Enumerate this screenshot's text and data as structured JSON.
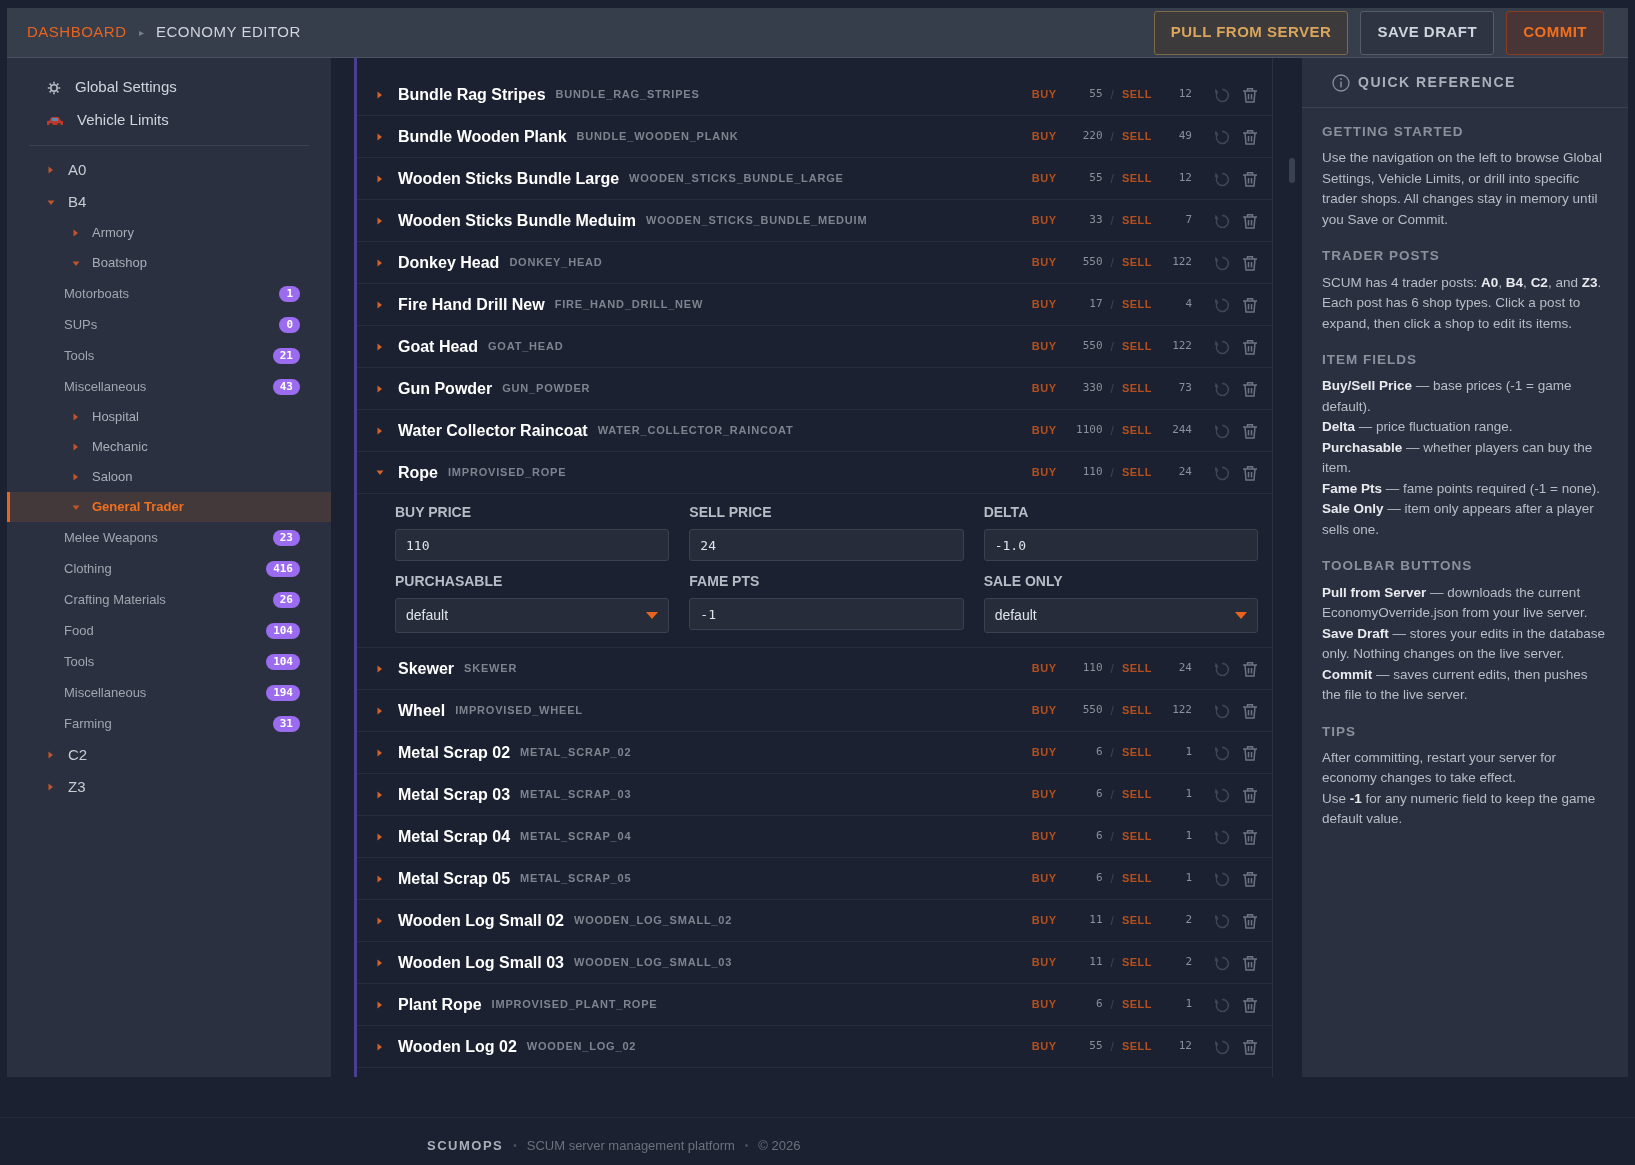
{
  "header": {
    "breadcrumb": [
      {
        "kind": "link",
        "text": "DASHBOARD"
      },
      {
        "kind": "sep",
        "text": "▸"
      },
      {
        "kind": "current",
        "text": "ECONOMY EDITOR"
      }
    ],
    "buttons": [
      {
        "kind": "pull",
        "label": "PULL FROM SERVER"
      },
      {
        "kind": "save",
        "label": "SAVE DRAFT"
      },
      {
        "kind": "commit",
        "label": "COMMIT"
      }
    ]
  },
  "sidebar": {
    "top_items": [
      {
        "kind": "gear",
        "label": "Global Settings"
      },
      {
        "kind": "car",
        "label": "Vehicle Limits"
      }
    ],
    "posts": [
      {
        "label": "A0",
        "expanded": false
      },
      {
        "label": "B4",
        "expanded": true,
        "children": [
          {
            "label": "Armory",
            "expanded": false,
            "selected": false
          },
          {
            "label": "Boatshop",
            "expanded": true,
            "selected": false,
            "children": [
              {
                "label": "Motorboats",
                "count": "1"
              },
              {
                "label": "SUPs",
                "count": "0"
              },
              {
                "label": "Tools",
                "count": "21"
              },
              {
                "label": "Miscellaneous",
                "count": "43"
              }
            ]
          },
          {
            "label": "Hospital",
            "expanded": false,
            "selected": false
          },
          {
            "label": "Mechanic",
            "expanded": false,
            "selected": false
          },
          {
            "label": "Saloon",
            "expanded": false,
            "selected": false
          },
          {
            "label": "General Trader",
            "expanded": true,
            "selected": true,
            "children": [
              {
                "label": "Melee Weapons",
                "count": "23"
              },
              {
                "label": "Clothing",
                "count": "416"
              },
              {
                "label": "Crafting Materials",
                "count": "26"
              },
              {
                "label": "Food",
                "count": "104"
              },
              {
                "label": "Tools",
                "count": "104"
              },
              {
                "label": "Miscellaneous",
                "count": "194"
              },
              {
                "label": "Farming",
                "count": "31"
              }
            ]
          }
        ]
      },
      {
        "label": "C2",
        "expanded": false
      },
      {
        "label": "Z3",
        "expanded": false
      }
    ]
  },
  "items": [
    {
      "name": "Bundle Rag Stripes",
      "code": "BUNDLE_RAG_STRIPES",
      "buy_label": "BUY",
      "buy": "55",
      "divider": "/",
      "sell_label": "SELL",
      "sell": "12",
      "expanded": false
    },
    {
      "name": "Bundle Wooden Plank",
      "code": "BUNDLE_WOODEN_PLANK",
      "buy_label": "BUY",
      "buy": "220",
      "divider": "/",
      "sell_label": "SELL",
      "sell": "49",
      "expanded": false
    },
    {
      "name": "Wooden Sticks Bundle Large",
      "code": "WOODEN_STICKS_BUNDLE_LARGE",
      "buy_label": "BUY",
      "buy": "55",
      "divider": "/",
      "sell_label": "SELL",
      "sell": "12",
      "expanded": false
    },
    {
      "name": "Wooden Sticks Bundle Meduim",
      "code": "WOODEN_STICKS_BUNDLE_MEDUIM",
      "buy_label": "BUY",
      "buy": "33",
      "divider": "/",
      "sell_label": "SELL",
      "sell": "7",
      "expanded": false
    },
    {
      "name": "Donkey Head",
      "code": "DONKEY_HEAD",
      "buy_label": "BUY",
      "buy": "550",
      "divider": "/",
      "sell_label": "SELL",
      "sell": "122",
      "expanded": false
    },
    {
      "name": "Fire Hand Drill New",
      "code": "FIRE_HAND_DRILL_NEW",
      "buy_label": "BUY",
      "buy": "17",
      "divider": "/",
      "sell_label": "SELL",
      "sell": "4",
      "expanded": false
    },
    {
      "name": "Goat Head",
      "code": "GOAT_HEAD",
      "buy_label": "BUY",
      "buy": "550",
      "divider": "/",
      "sell_label": "SELL",
      "sell": "122",
      "expanded": false
    },
    {
      "name": "Gun Powder",
      "code": "GUN_POWDER",
      "buy_label": "BUY",
      "buy": "330",
      "divider": "/",
      "sell_label": "SELL",
      "sell": "73",
      "expanded": false
    },
    {
      "name": "Water Collector Raincoat",
      "code": "WATER_COLLECTOR_RAINCOAT",
      "buy_label": "BUY",
      "buy": "1100",
      "divider": "/",
      "sell_label": "SELL",
      "sell": "244",
      "expanded": false
    },
    {
      "name": "Rope",
      "code": "IMPROVISED_ROPE",
      "buy_label": "BUY",
      "buy": "110",
      "divider": "/",
      "sell_label": "SELL",
      "sell": "24",
      "expanded": true,
      "fields": [
        {
          "label": "BUY PRICE",
          "kind": "input",
          "value": "110"
        },
        {
          "label": "SELL PRICE",
          "kind": "input",
          "value": "24"
        },
        {
          "label": "DELTA",
          "kind": "input",
          "value": "-1.0"
        },
        {
          "label": "PURCHASABLE",
          "kind": "select",
          "value": "default"
        },
        {
          "label": "FAME PTS",
          "kind": "input",
          "value": "-1"
        },
        {
          "label": "SALE ONLY",
          "kind": "select",
          "value": "default"
        }
      ]
    },
    {
      "name": "Skewer",
      "code": "SKEWER",
      "buy_label": "BUY",
      "buy": "110",
      "divider": "/",
      "sell_label": "SELL",
      "sell": "24",
      "expanded": false
    },
    {
      "name": "Wheel",
      "code": "IMPROVISED_WHEEL",
      "buy_label": "BUY",
      "buy": "550",
      "divider": "/",
      "sell_label": "SELL",
      "sell": "122",
      "expanded": false
    },
    {
      "name": "Metal Scrap 02",
      "code": "METAL_SCRAP_02",
      "buy_label": "BUY",
      "buy": "6",
      "divider": "/",
      "sell_label": "SELL",
      "sell": "1",
      "expanded": false
    },
    {
      "name": "Metal Scrap 03",
      "code": "METAL_SCRAP_03",
      "buy_label": "BUY",
      "buy": "6",
      "divider": "/",
      "sell_label": "SELL",
      "sell": "1",
      "expanded": false
    },
    {
      "name": "Metal Scrap 04",
      "code": "METAL_SCRAP_04",
      "buy_label": "BUY",
      "buy": "6",
      "divider": "/",
      "sell_label": "SELL",
      "sell": "1",
      "expanded": false
    },
    {
      "name": "Metal Scrap 05",
      "code": "METAL_SCRAP_05",
      "buy_label": "BUY",
      "buy": "6",
      "divider": "/",
      "sell_label": "SELL",
      "sell": "1",
      "expanded": false
    },
    {
      "name": "Wooden Log Small 02",
      "code": "WOODEN_LOG_SMALL_02",
      "buy_label": "BUY",
      "buy": "11",
      "divider": "/",
      "sell_label": "SELL",
      "sell": "2",
      "expanded": false
    },
    {
      "name": "Wooden Log Small 03",
      "code": "WOODEN_LOG_SMALL_03",
      "buy_label": "BUY",
      "buy": "11",
      "divider": "/",
      "sell_label": "SELL",
      "sell": "2",
      "expanded": false
    },
    {
      "name": "Plant Rope",
      "code": "IMPROVISED_PLANT_ROPE",
      "buy_label": "BUY",
      "buy": "6",
      "divider": "/",
      "sell_label": "SELL",
      "sell": "1",
      "expanded": false
    },
    {
      "name": "Wooden Log 02",
      "code": "WOODEN_LOG_02",
      "buy_label": "BUY",
      "buy": "55",
      "divider": "/",
      "sell_label": "SELL",
      "sell": "12",
      "expanded": false
    }
  ],
  "reference": {
    "title": "QUICK REFERENCE",
    "sections": [
      {
        "heading": "GETTING STARTED",
        "lines": [
          "Use the navigation on the left to browse Global Settings, Vehicle Limits, or drill into specific trader shops. All changes stay in memory until you Save or Commit."
        ]
      },
      {
        "heading": "TRADER POSTS",
        "lines": [
          "SCUM has 4 trader posts: **A0**, **B4**, **C2**, and **Z3**. Each post has 6 shop types. Click a post to expand, then click a shop to edit its items."
        ]
      },
      {
        "heading": "ITEM FIELDS",
        "lines": [
          "**Buy/Sell Price** — base prices (-1 = game default).",
          "**Delta** — price fluctuation range.",
          "**Purchasable** — whether players can buy the item.",
          "**Fame Pts** — fame points required (-1 = none).",
          "**Sale Only** — item only appears after a player sells one."
        ]
      },
      {
        "heading": "TOOLBAR BUTTONS",
        "lines": [
          "**Pull from Server** — downloads the current EconomyOverride.json from your live server.",
          "**Save Draft** — stores your edits in the database only. Nothing changes on the live server.",
          "**Commit** — saves current edits, then pushes the file to the live server."
        ]
      },
      {
        "heading": "TIPS",
        "lines": [
          "After committing, restart your server for economy changes to take effect.",
          "Use **-1** for any numeric field to keep the game default value."
        ]
      }
    ]
  },
  "footer": [
    {
      "kind": "brand",
      "text": "SCUMOPS"
    },
    {
      "kind": "sep",
      "text": "•"
    },
    {
      "kind": "text",
      "text": "SCUM server management platform"
    },
    {
      "kind": "sep",
      "text": "•"
    },
    {
      "kind": "text",
      "text": "© 2026"
    }
  ]
}
